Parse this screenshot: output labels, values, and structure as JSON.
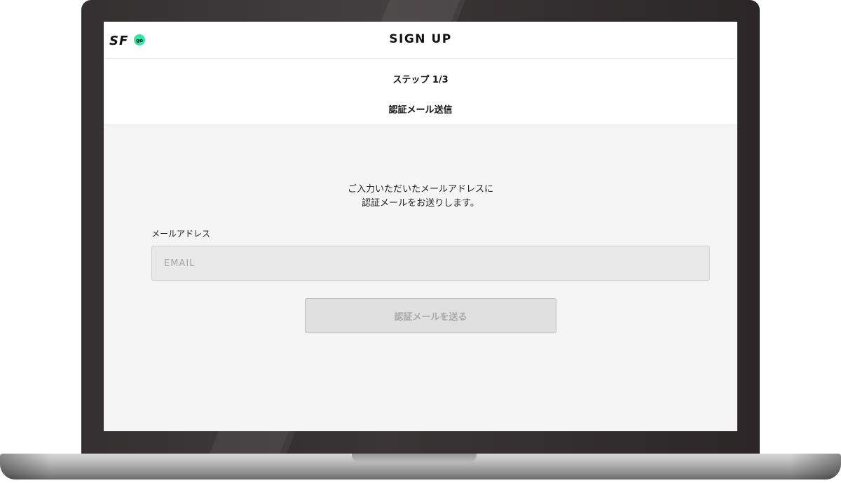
{
  "header": {
    "title": "SIGN UP",
    "logo_text": "SF",
    "logo_badge_text": "go",
    "logo_accent_color": "#2ee6a8"
  },
  "step": {
    "label": "ステップ 1/3",
    "name": "認証メール送信"
  },
  "main": {
    "intro_line1": "ご入力いただいたメールアドレスに",
    "intro_line2": "認証メールをお送りします。",
    "email_label": "メールアドレス",
    "email_placeholder": "EMAIL",
    "email_value": "",
    "submit_label": "認証メールを送る",
    "submit_enabled": false
  },
  "colors": {
    "screen_background": "#f5f5f5",
    "header_background": "#ffffff",
    "bezel": "#2a2526",
    "button_disabled_bg": "#e0e0e0",
    "button_disabled_text": "#a9a9a9"
  }
}
